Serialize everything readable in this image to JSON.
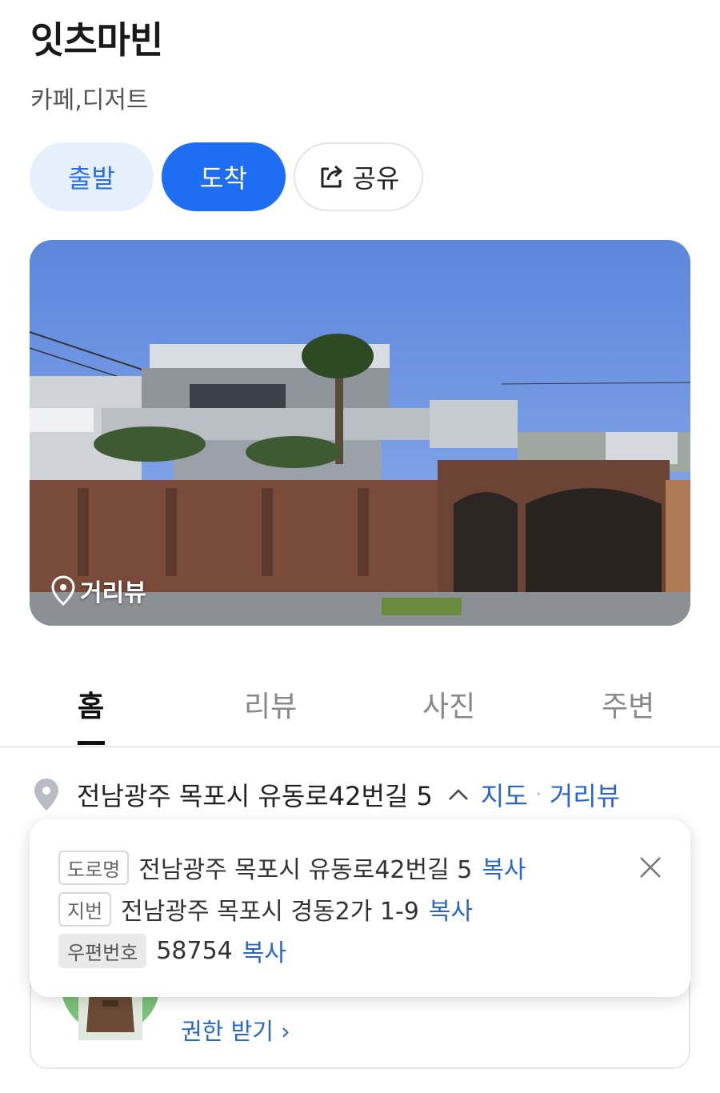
{
  "place": {
    "name": "잇츠마빈",
    "category": "카페,디저트"
  },
  "actions": {
    "depart_label": "출발",
    "arrive_label": "도착",
    "share_label": "공유"
  },
  "photo": {
    "street_view_label": "거리뷰"
  },
  "tabs": [
    {
      "label": "홈",
      "active": true
    },
    {
      "label": "리뷰",
      "active": false
    },
    {
      "label": "사진",
      "active": false
    },
    {
      "label": "주변",
      "active": false
    }
  ],
  "address": {
    "summary": "전남광주 목포시 유동로42번길 5",
    "map_link": "지도",
    "dot": "·",
    "street_view_link": "거리뷰"
  },
  "address_popup": {
    "road_tag": "도로명",
    "road_address": "전남광주 목포시 유동로42번길 5",
    "lot_tag": "지번",
    "lot_address": "전남광주 목포시 경동2가 1-9",
    "postal_tag": "우편번호",
    "postal_code": "58754",
    "copy_label": "복사"
  },
  "owner_card": {
    "permission_link": "권한 받기"
  },
  "colors": {
    "accent": "#1e6ef4",
    "link": "#2a66c9",
    "depart_bg": "#e6f0fc"
  }
}
